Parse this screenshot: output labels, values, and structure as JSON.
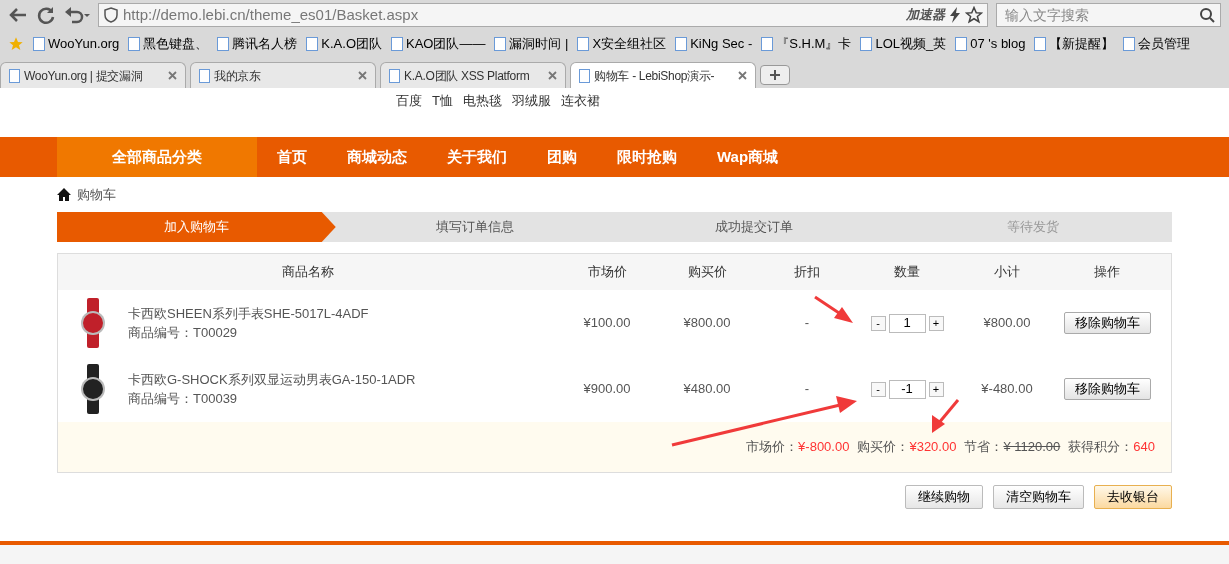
{
  "browser": {
    "address": "http://demo.lebi.cn/theme_es01/Basket.aspx",
    "accelerator": "加速器",
    "search": {
      "placeholder": "输入文字搜索"
    },
    "bookmarks": [
      "WooYun.org",
      "黑色键盘、",
      "腾讯名人榜",
      "K.A.O团队",
      "KAO团队——",
      "漏洞时间 |",
      "X安全组社区",
      "KiNg Sec -",
      "『S.H.M』卡",
      "LOL视频_英",
      "07 's blog",
      "【新提醒】",
      "会员管理"
    ],
    "tabs": [
      {
        "label": "WooYun.org | 提交漏洞",
        "selected": false
      },
      {
        "label": "我的京东",
        "selected": false
      },
      {
        "label": "K.A.O团队 XSS Platform",
        "selected": false
      },
      {
        "label": "购物车 - LebiShop演示-",
        "selected": true
      }
    ]
  },
  "hot_words": [
    "百度",
    "T恤",
    "电热毯",
    "羽绒服",
    "连衣裙"
  ],
  "nav": [
    {
      "label": "全部商品分类",
      "selected": true
    },
    {
      "label": "首页",
      "selected": false
    },
    {
      "label": "商城动态",
      "selected": false
    },
    {
      "label": "关于我们",
      "selected": false
    },
    {
      "label": "团购",
      "selected": false
    },
    {
      "label": "限时抢购",
      "selected": false
    },
    {
      "label": "Wap商城",
      "selected": false
    }
  ],
  "breadcrumb": "购物车",
  "steps": [
    {
      "label": "加入购物车",
      "selected": true
    },
    {
      "label": "填写订单信息",
      "selected": false
    },
    {
      "label": "成功提交订单",
      "selected": false
    },
    {
      "label": "等待发货",
      "selected": false
    }
  ],
  "table": {
    "columns": [
      "商品名称",
      "市场价",
      "购买价",
      "折扣",
      "数量",
      "小计",
      "操作"
    ],
    "rows": [
      {
        "name": "卡西欧SHEEN系列手表SHE-5017L-4ADF",
        "code": "商品编号：T00029",
        "market_price": "¥100.00",
        "price": "¥800.00",
        "discount": "-",
        "minus": "-",
        "quantity": "1",
        "plus": "+",
        "subtotal": "¥800.00",
        "action": "移除购物车",
        "color": "#c0202a"
      },
      {
        "name": "卡西欧G-SHOCK系列双显运动男表GA-150-1ADR",
        "code": "商品编号：T00039",
        "market_price": "¥900.00",
        "price": "¥480.00",
        "discount": "-",
        "minus": "-",
        "quantity": "-1",
        "plus": "+",
        "subtotal": "¥-480.00",
        "action": "移除购物车",
        "color": "#222222"
      }
    ]
  },
  "summary": [
    {
      "label": "市场价：",
      "value": "¥-800.00",
      "struck": false
    },
    {
      "label": "购买价：",
      "value": "¥320.00",
      "struck": false
    },
    {
      "label": "节省：",
      "value": "¥ 1120.00",
      "struck": true
    },
    {
      "label": "获得积分：",
      "value": "640",
      "struck": false
    }
  ],
  "buttons": [
    {
      "label": "继续购物",
      "kind": "plain"
    },
    {
      "label": "清空购物车",
      "kind": "plain"
    },
    {
      "label": "去收银台",
      "kind": "primary"
    }
  ]
}
